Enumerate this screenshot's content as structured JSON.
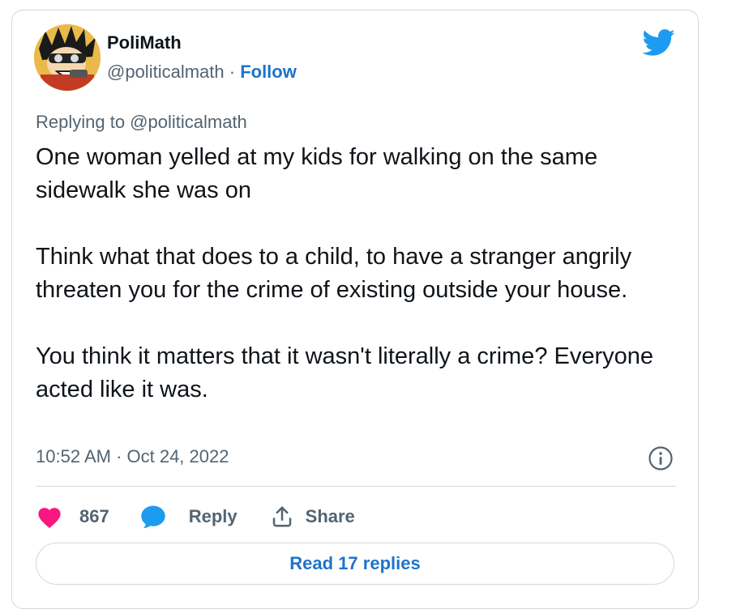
{
  "author": {
    "name": "PoliMath",
    "handle": "@politicalmath",
    "separator": " · ",
    "follow_label": "Follow"
  },
  "replying_to": "Replying to @politicalmath",
  "tweet": {
    "paragraphs": [
      "One woman yelled at my kids for walking on the same sidewalk she was on",
      "Think what that does to a child, to have a stranger angrily threaten you for the crime of existing outside your house.",
      "You think it matters that it wasn't literally a crime? Everyone acted like it was."
    ],
    "timestamp": "10:52 AM · Oct 24, 2022"
  },
  "actions": {
    "like_count": "867",
    "reply_label": "Reply",
    "share_label": "Share"
  },
  "read_replies_label": "Read 17 replies",
  "colors": {
    "like": "#f91880",
    "accent": "#1d9bf0",
    "link": "#1d74c9",
    "muted": "#536471",
    "border": "#cfd9de"
  },
  "icons": {
    "brand": "twitter-bird-icon",
    "info": "info-icon",
    "like": "heart-icon",
    "reply": "speech-bubble-icon",
    "share": "share-upload-icon"
  }
}
